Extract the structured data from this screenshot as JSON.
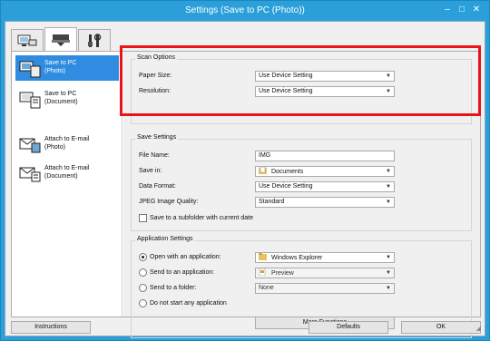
{
  "window": {
    "title": "Settings (Save to PC (Photo))",
    "minimize": "–",
    "maximize": "□",
    "close": "✕"
  },
  "tabs": [
    {
      "icon": "scan-from-computer-icon"
    },
    {
      "icon": "scan-from-operation-panel-icon",
      "active": true
    },
    {
      "icon": "general-settings-icon"
    }
  ],
  "left_list": [
    {
      "label_1": "Save to PC",
      "label_2": "(Photo)",
      "icon": "save-photo-icon",
      "selected": true
    },
    {
      "label_1": "Save to PC",
      "label_2": "(Document)",
      "icon": "save-document-icon"
    },
    {
      "label_1": "Attach to E-mail",
      "label_2": "(Photo)",
      "icon": "email-photo-icon"
    },
    {
      "label_1": "Attach to E-mail",
      "label_2": "(Document)",
      "icon": "email-document-icon"
    }
  ],
  "scan_options": {
    "title": "Scan Options",
    "paper_size_label": "Paper Size:",
    "paper_size_value": "Use Device Setting",
    "resolution_label": "Resolution:",
    "resolution_value": "Use Device Setting"
  },
  "save_settings": {
    "title": "Save Settings",
    "file_name_label": "File Name:",
    "file_name_value": "IMG",
    "save_in_label": "Save in:",
    "save_in_value": "Documents",
    "data_format_label": "Data Format:",
    "data_format_value": "Use Device Setting",
    "jpeg_quality_label": "JPEG Image Quality:",
    "jpeg_quality_value": "Standard",
    "subfolder_label": "Save to a subfolder with current date"
  },
  "application_settings": {
    "title": "Application Settings",
    "open_app_label": "Open with an application:",
    "open_app_value": "Windows Explorer",
    "send_app_label": "Send to an application:",
    "send_app_value": "Preview",
    "send_folder_label": "Send to a folder:",
    "send_folder_value": "None",
    "no_app_label": "Do not start any application",
    "more_functions": "More Functions",
    "selected_option": "open_app"
  },
  "footer": {
    "instructions": "Instructions",
    "defaults": "Defaults",
    "ok": "OK"
  },
  "colors": {
    "titlebar": "#2a9fd9",
    "selection": "#2f8ce0",
    "highlight": "#e8141c"
  }
}
